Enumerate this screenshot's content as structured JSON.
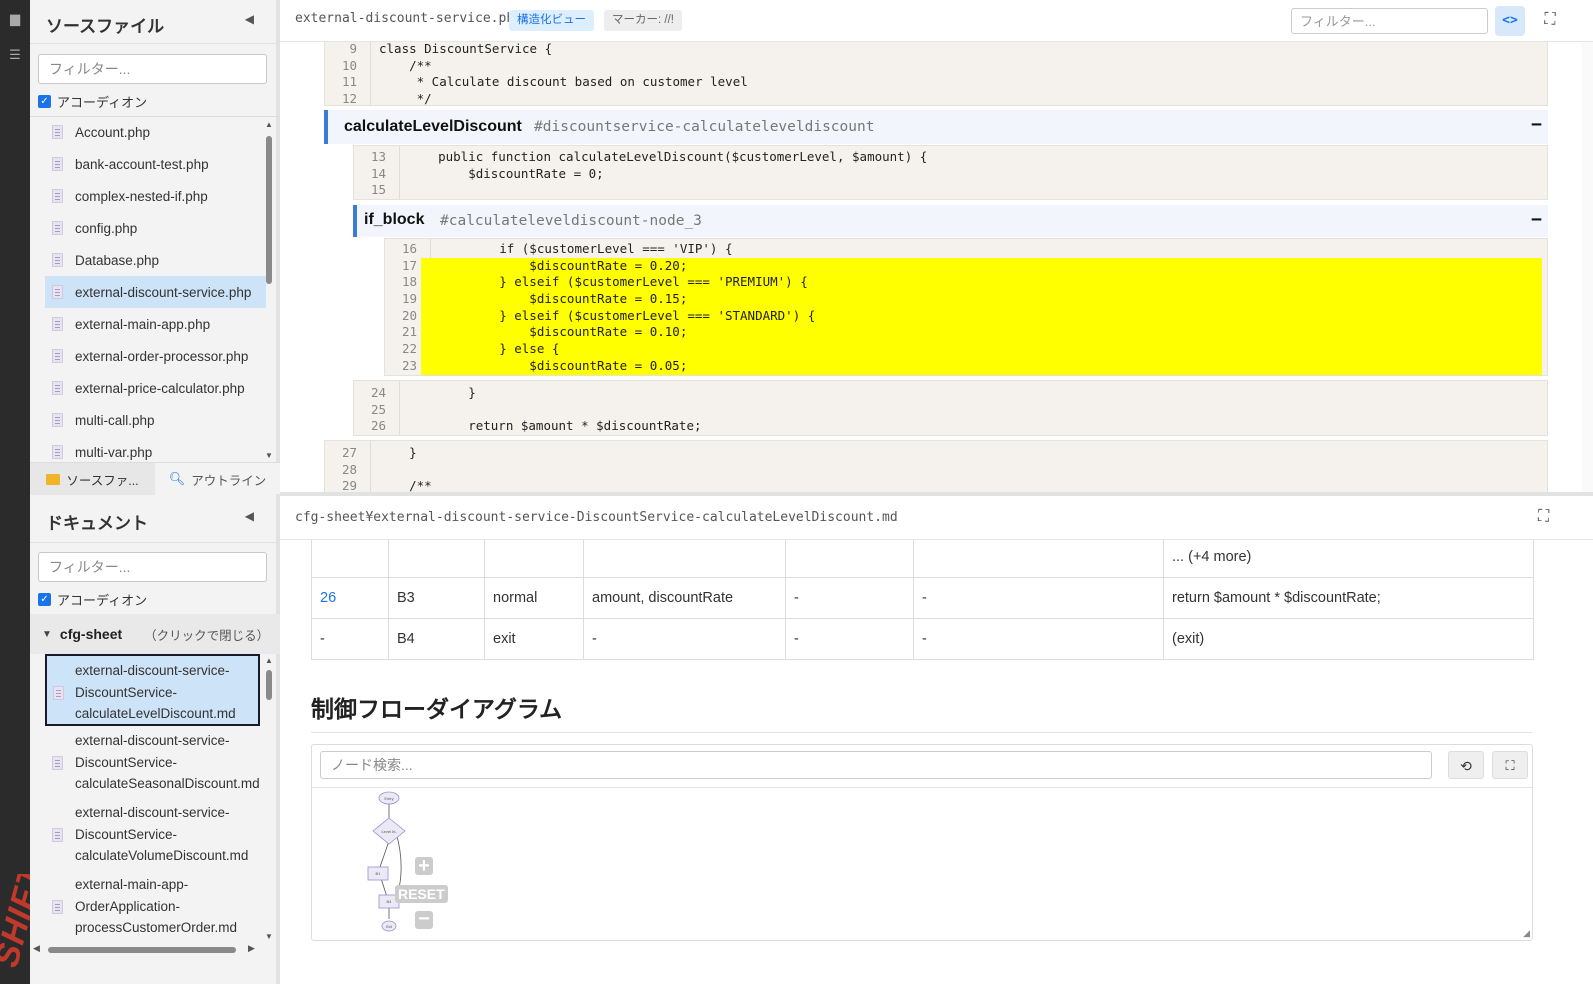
{
  "sidebar": {
    "source_title": "ソースファイル",
    "filter_placeholder": "フィルター...",
    "accordion_label": "アコーディオン",
    "files": [
      "Account.php",
      "bank-account-test.php",
      "complex-nested-if.php",
      "config.php",
      "Database.php",
      "external-discount-service.php",
      "external-main-app.php",
      "external-order-processor.php",
      "external-price-calculator.php",
      "multi-call.php",
      "multi-var.php"
    ],
    "selected_file_index": 5,
    "tab_source": "ソースファ...",
    "tab_outline": "アウトライン",
    "doc_title": "ドキュメント",
    "doc_filter_placeholder": "フィルター...",
    "doc_accordion_label": "アコーディオン",
    "tree_folder": "cfg-sheet",
    "tree_hint": "（クリックで閉じる）",
    "docs": [
      [
        "external-discount-service-",
        "DiscountService-",
        "calculateLevelDiscount.md"
      ],
      [
        "external-discount-service-",
        "DiscountService-",
        "calculateSeasonalDiscount.md"
      ],
      [
        "external-discount-service-",
        "DiscountService-",
        "calculateVolumeDiscount.md"
      ],
      [
        "external-main-app-",
        "OrderApplication-",
        "processCustomerOrder.md"
      ]
    ],
    "brand": "SHIFT"
  },
  "editor": {
    "file": "external-discount-service.php",
    "badge_structured": "構造化ビュー",
    "badge_marker": "マーカー: //!",
    "filter_placeholder": "フィルター...",
    "code_btn": "<>",
    "lines_top": [
      {
        "n": "9",
        "t": "class DiscountService {"
      },
      {
        "n": "10",
        "t": "    /**"
      },
      {
        "n": "11",
        "t": "     * Calculate discount based on customer level"
      },
      {
        "n": "12",
        "t": "     */"
      }
    ],
    "node1": {
      "name": "calculateLevelDiscount",
      "anchor": "#discountservice-calculateleveldiscount",
      "toggle": "−"
    },
    "lines_fn": [
      {
        "n": "13",
        "t": "    public function calculateLevelDiscount($customerLevel, $amount) {"
      },
      {
        "n": "14",
        "t": "        $discountRate = 0;"
      },
      {
        "n": "15",
        "t": ""
      }
    ],
    "node2": {
      "name": "if_block",
      "anchor": "#calculateleveldiscount-node_3",
      "toggle": "−"
    },
    "lines_if": [
      {
        "n": "16",
        "t": "        if ($customerLevel === 'VIP') {",
        "hl": false
      },
      {
        "n": "17",
        "t": "            $discountRate = 0.20;",
        "hl": true
      },
      {
        "n": "18",
        "t": "        } elseif ($customerLevel === 'PREMIUM') {",
        "hl": true
      },
      {
        "n": "19",
        "t": "            $discountRate = 0.15;",
        "hl": true
      },
      {
        "n": "20",
        "t": "        } elseif ($customerLevel === 'STANDARD') {",
        "hl": true
      },
      {
        "n": "21",
        "t": "            $discountRate = 0.10;",
        "hl": true
      },
      {
        "n": "22",
        "t": "        } else {",
        "hl": true
      },
      {
        "n": "23",
        "t": "            $discountRate = 0.05;",
        "hl": true
      }
    ],
    "lines_after": [
      {
        "n": "24",
        "t": "        }"
      },
      {
        "n": "25",
        "t": ""
      },
      {
        "n": "26",
        "t": "        return $amount * $discountRate;"
      }
    ],
    "lines_bottom": [
      {
        "n": "27",
        "t": "    }"
      },
      {
        "n": "28",
        "t": ""
      },
      {
        "n": "29",
        "t": "    /**"
      }
    ]
  },
  "doc": {
    "path": "cfg-sheet¥external-discount-service-DiscountService-calculateLevelDiscount.md",
    "table_rows": [
      [
        "",
        "",
        "",
        "",
        "",
        "",
        "... (+4 more)"
      ],
      [
        "26",
        "B3",
        "normal",
        "amount, discountRate",
        "-",
        "-",
        "return $amount * $discountRate;"
      ],
      [
        "-",
        "B4",
        "exit",
        "-",
        "-",
        "-",
        "(exit)"
      ]
    ],
    "heading": "制御フローダイアグラム",
    "node_search_placeholder": "ノード検索...",
    "reset_label": "RESET",
    "graph_nodes": [
      "Entry",
      "Level bL",
      "B1",
      "B4",
      "Exit"
    ]
  }
}
